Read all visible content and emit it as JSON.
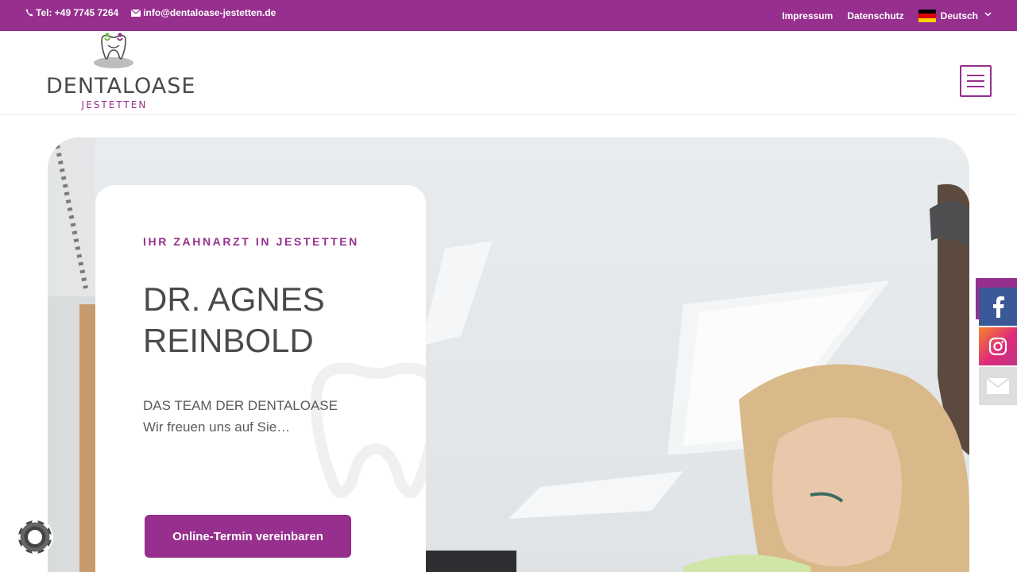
{
  "topbar": {
    "phone": "Tel: +49 7745 7264",
    "email": "info@dentaloase-jestetten.de",
    "links": [
      "Impressum",
      "Datenschutz"
    ],
    "language": "Deutsch"
  },
  "header": {
    "logo_word": "DENTALOASE",
    "logo_sub": "JESTETTEN"
  },
  "hero": {
    "eyebrow": "IHR ZAHNARZT IN JESTETTEN",
    "title_line1": "DR. AGNES",
    "title_line2": "REINBOLD",
    "subtitle": "DAS TEAM DER DENTALOASE",
    "lead": "Wir freuen uns auf Sie…",
    "cta": "Online-Termin vereinbaren"
  },
  "social": {
    "icons": [
      "facebook-icon",
      "instagram-icon",
      "mail-icon"
    ]
  },
  "colors": {
    "brand": "#972f8e",
    "facebook": "#3b5998",
    "text": "#4a4a4a"
  }
}
